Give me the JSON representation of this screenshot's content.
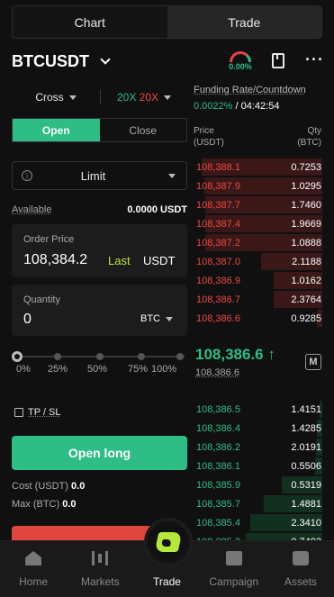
{
  "tabs": [
    {
      "label": "Chart",
      "active": false
    },
    {
      "label": "Trade",
      "active": true
    }
  ],
  "header": {
    "pair": "BTCUSDT",
    "gauge_pct": "0.00%"
  },
  "left": {
    "margin_mode": "Cross",
    "lev_long": "20X",
    "lev_short": "20X",
    "open_label": "Open",
    "close_label": "Close",
    "order_type": "Limit",
    "available_label": "Available",
    "available_value": "0.0000 USDT",
    "order_price_label": "Order Price",
    "order_price_value": "108,384.2",
    "last_label": "Last",
    "price_unit": "USDT",
    "quantity_label": "Quantity",
    "quantity_value": "0",
    "quantity_unit": "BTC",
    "slider_value_pct": 0,
    "slider_ticks": [
      "0%",
      "25%",
      "50%",
      "75%",
      "100%"
    ],
    "tpsl_label": "TP / SL",
    "open_long_label": "Open long",
    "cost_label": "Cost (USDT)",
    "cost_value": "0.0",
    "max_label": "Max (BTC)",
    "max_value": "0.0"
  },
  "right": {
    "funding_title": "Funding Rate/Countdown",
    "funding_rate": "0.0022%",
    "countdown": "/ 04:42:54",
    "col_price": "Price",
    "col_price_unit": "(USDT)",
    "col_qty": "Qty",
    "col_qty_unit": "(BTC)",
    "asks": [
      {
        "price": "108,388.1",
        "qty": "0.7253",
        "depth": 0.95
      },
      {
        "price": "108,387.9",
        "qty": "1.0295",
        "depth": 0.93
      },
      {
        "price": "108,387.7",
        "qty": "1.7460",
        "depth": 0.92
      },
      {
        "price": "108,387.4",
        "qty": "1.9669",
        "depth": 0.92
      },
      {
        "price": "108,387.2",
        "qty": "1.0888",
        "depth": 0.92
      },
      {
        "price": "108,387.0",
        "qty": "2.1188",
        "depth": 0.48
      },
      {
        "price": "108,386.9",
        "qty": "1.0162",
        "depth": 0.38
      },
      {
        "price": "108,386.7",
        "qty": "2.3764",
        "depth": 0.38
      },
      {
        "price": "108,386.6",
        "qty": "0.9285",
        "depth": 0.04
      }
    ],
    "mid_price": "108,386.6",
    "mid_arrow": "↑",
    "mark_price": "108,386.6",
    "bids": [
      {
        "price": "108,386.5",
        "qty": "1.4151",
        "depth": 0.02
      },
      {
        "price": "108,386.4",
        "qty": "1.4285",
        "depth": 0.04
      },
      {
        "price": "108,386.2",
        "qty": "2.0191",
        "depth": 0.05
      },
      {
        "price": "108,386.1",
        "qty": "0.5506",
        "depth": 0.06
      },
      {
        "price": "108,385.9",
        "qty": "0.5319",
        "depth": 0.32
      },
      {
        "price": "108,385.7",
        "qty": "1.4881",
        "depth": 0.46
      },
      {
        "price": "108,385.4",
        "qty": "2.3410",
        "depth": 0.57
      },
      {
        "price": "108,385.2",
        "qty": "0.7403",
        "depth": 0.6
      }
    ]
  },
  "nav": [
    {
      "label": "Home",
      "icon": "home-icon"
    },
    {
      "label": "Markets",
      "icon": "markets-icon"
    },
    {
      "label": "Trade",
      "icon": "trade-icon",
      "active": true
    },
    {
      "label": "Campaign",
      "icon": "campaign-icon"
    },
    {
      "label": "Assets",
      "icon": "assets-icon"
    }
  ],
  "colors": {
    "green": "#2dbd85",
    "red": "#f0473f",
    "accent": "#b6e83c"
  }
}
